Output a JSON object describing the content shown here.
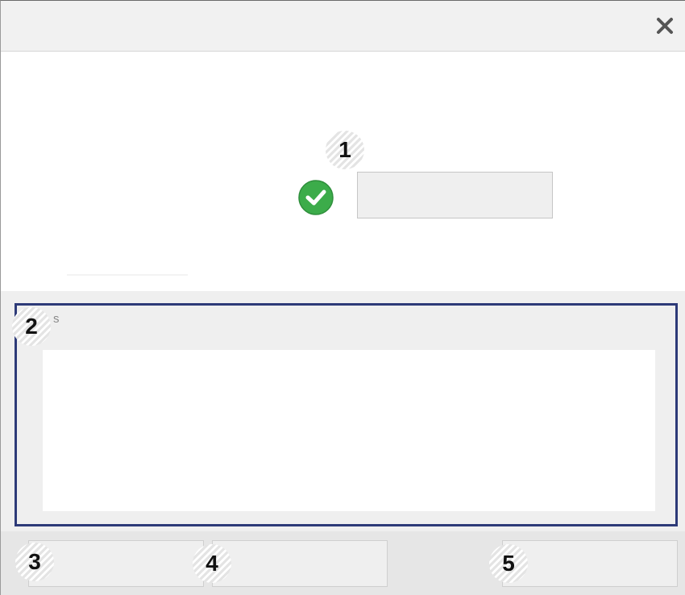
{
  "window": {
    "close_icon": "close-icon"
  },
  "callouts": {
    "c1": "1",
    "c2": "2",
    "c3": "3",
    "c4": "4",
    "c5": "5"
  },
  "status": {
    "icon": "check-circle-icon",
    "icon_color": "#3cac4a",
    "field_value": ""
  },
  "group": {
    "label": "s",
    "text_value": "",
    "border_color": "#2d3a78"
  },
  "buttons": {
    "button_3_label": "",
    "button_4_label": "",
    "button_5_label": ""
  }
}
